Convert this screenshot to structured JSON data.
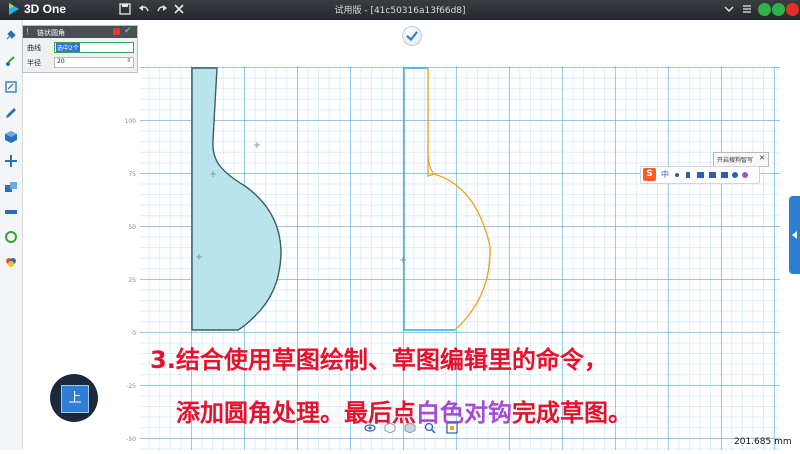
{
  "app": {
    "name": "3D One",
    "window_title": "试用版 - [41c50316a13f66d8]"
  },
  "titlebar_icons": [
    "save-icon",
    "undo-icon",
    "redo-icon",
    "close-tool-icon"
  ],
  "window_controls": [
    "minimize-button",
    "maximize-button",
    "close-button"
  ],
  "left_toolbar": {
    "icons": [
      "pin-icon",
      "brush-icon",
      "sketch-icon",
      "edit-icon",
      "cube-icon",
      "move-icon",
      "combine-icon",
      "measure-icon",
      "rotate-icon",
      "color-icon"
    ]
  },
  "panel": {
    "title": "链状圆角",
    "fields": [
      {
        "label": "曲线",
        "value": "选中2个"
      },
      {
        "label": "半径",
        "value": "20"
      }
    ]
  },
  "axis": {
    "y_labels": [
      "100",
      "75",
      "50",
      "25",
      "0",
      "-25",
      "-50"
    ]
  },
  "view_cube": {
    "label": "上"
  },
  "status": {
    "distance": "201.685 mm"
  },
  "ime": {
    "tooltip": "开启搜狗智写",
    "label": "S"
  },
  "caption": {
    "line1": "3.结合使用草图绘制、草图编辑里的命令，",
    "line2_prefix": "添加圆角处理。最后点",
    "line2_highlight": "白色对钩",
    "line2_suffix": "完成草图。"
  },
  "colors": {
    "shape_fill": "#b9e4ee",
    "shape_stroke": "#3e5c66",
    "right_stroke_orange": "#f0a321",
    "right_stroke_blue": "#3aa8d8",
    "caption_red": "#e8102a",
    "caption_purple": "#a64bd6"
  }
}
